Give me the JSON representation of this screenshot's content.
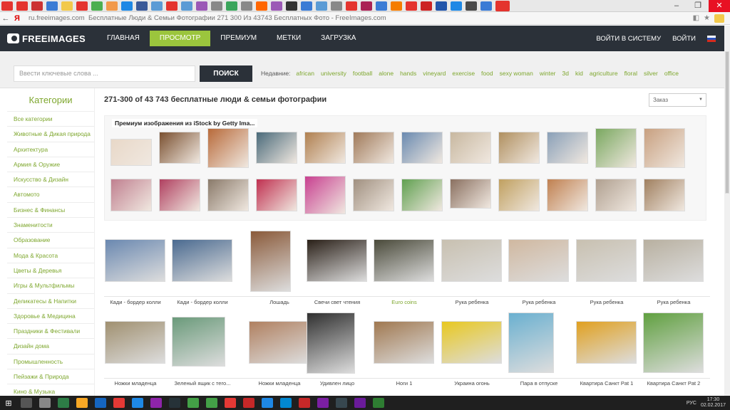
{
  "browser": {
    "tab_colors": [
      "#e4342e",
      "#e4342e",
      "#cc3333",
      "#3a7bd5",
      "#f2c94c",
      "#e4342e",
      "#4caf50",
      "#f2994a",
      "#1e88e5",
      "#3a5998",
      "#5b9bd5",
      "#e4342e",
      "#5b9bd5",
      "#9b59b6",
      "#888888",
      "#3ba55c",
      "#888888",
      "#ff6600",
      "#9b59b6",
      "#333333",
      "#3a7bd5",
      "#5b9bd5",
      "#888888",
      "#e4342e",
      "#aa2255",
      "#3a7bd5",
      "#f57c00",
      "#e4342e",
      "#cc2222",
      "#2255aa",
      "#1e88e5",
      "#4a4a4a",
      "#3a7bd5",
      "#e4342e"
    ],
    "url_domain": "ru.freeimages.com",
    "page_title": "Бесплатные Люди & Семьи Фотографии 271 300 Из 43743 Бесплатных Фото - FreeImages.com",
    "win_minimize": "–",
    "win_restore": "❐",
    "win_close": "✕"
  },
  "site": {
    "logo_text": "FREEIMAGES",
    "nav": [
      "ГЛАВНАЯ",
      "ПРОСМОТР",
      "ПРЕМИУМ",
      "МЕТКИ",
      "ЗАГРУЗКА"
    ],
    "selected_nav": "ПРОСМОТР",
    "login": "ВОЙТИ В СИСТЕМУ",
    "signup": "ВОЙТИ",
    "brand_color": "#9bc53d",
    "header_color": "#2b3139"
  },
  "search": {
    "placeholder": "Ввести ключевые слова ...",
    "button": "ПОИСК",
    "recent_label": "Недавние:",
    "recent_tags": [
      "african",
      "university",
      "football",
      "alone",
      "hands",
      "vineyard",
      "exercise",
      "food",
      "sexy woman",
      "winter",
      "3d",
      "kid",
      "agriculture",
      "floral",
      "silver",
      "office"
    ]
  },
  "sidebar": {
    "heading": "Категории",
    "items": [
      "Все категории",
      "Животные & Дикая природа",
      "Архитектура",
      "Армия & Оружие",
      "Искусство & Дизайн",
      "Автомото",
      "Бизнес & Финансы",
      "Знаменитости",
      "Образование",
      "Мода & Красота",
      "Цветы & Деревья",
      "Игры & Мультфильмы",
      "Деликатесы & Напитки",
      "Здоровье & Медицина",
      "Праздники & Фестивали",
      "Дизайн дома",
      "Промышленность",
      "Пейзажи & Природа",
      "Кино & Музыка"
    ]
  },
  "results": {
    "title": "271-300 of 43 743 бесплатные люди & семьи фотографии",
    "sort_label": "Заказ",
    "premium_title": "Премиум изображения из iStock by Getty Ima...",
    "premium_colors": [
      "#e8d8c8",
      "#7a5030",
      "#b86a3a",
      "#4a6a7a",
      "#b08050",
      "#a07a5a",
      "#6a8ab0",
      "#c8b8a0",
      "#b09060",
      "#8aa0b8",
      "#7aa860",
      "#c8a080",
      "#c08090",
      "#b04060",
      "#8a7a6a",
      "#c03050",
      "#c84090",
      "#a09080",
      "#60a050",
      "#8a7060",
      "#c0a060",
      "#c08050",
      "#b0a090",
      "#a08060"
    ],
    "free_items": [
      {
        "caption": "Кади - бордер колли",
        "color": "#6a88b0"
      },
      {
        "caption": "Кади - бордер колли",
        "color": "#4a6a90"
      },
      {
        "caption": "Лошадь",
        "color": "#8a5a3a"
      },
      {
        "caption": "Свечи свет чтения",
        "color": "#2a2018"
      },
      {
        "caption": "Euro coins",
        "color": "#4a4a3a"
      },
      {
        "caption": "Рука ребенка",
        "color": "#c8c0b0"
      },
      {
        "caption": "Рука ребенка",
        "color": "#d0b8a0"
      },
      {
        "caption": "Рука ребенка",
        "color": "#c8c0b0"
      },
      {
        "caption": "Рука ребенка",
        "color": "#b8b0a0"
      },
      {
        "caption": "Ножки младенца",
        "color": "#a09070"
      },
      {
        "caption": "Зеленый ящик с тего...",
        "color": "#6a9a7a"
      },
      {
        "caption": "Ножки младенца",
        "color": "#b08060"
      },
      {
        "caption": "Удивлен лицо",
        "color": "#303030"
      },
      {
        "caption": "Ноги 1",
        "color": "#a07850"
      },
      {
        "caption": "Украина огонь",
        "color": "#e8c820"
      },
      {
        "caption": "Пара в отпуске",
        "color": "#6ab0d0"
      },
      {
        "caption": "Квартира Санкт Pat 1",
        "color": "#e0a020"
      },
      {
        "caption": "Квартира Санкт Pat 2",
        "color": "#60a040"
      }
    ]
  },
  "taskbar": {
    "lang": "РУС",
    "time": "17:30",
    "date": "02.02.2017"
  }
}
